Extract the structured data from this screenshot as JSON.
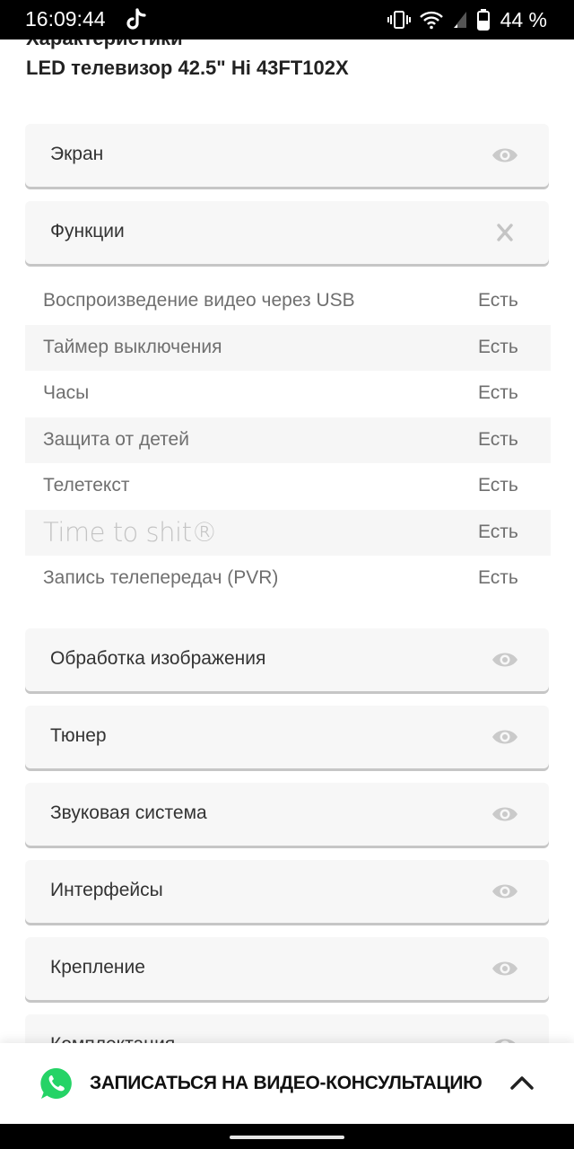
{
  "status_bar": {
    "time": "16:09:44",
    "battery": "44 %"
  },
  "page": {
    "heading": "Характеристики",
    "product": "LED телевизор 42.5\" Hi 43FT102X"
  },
  "sections_top": [
    {
      "label": "Экран",
      "icon": "eye-icon"
    },
    {
      "label": "Функции",
      "icon": "close-icon"
    }
  ],
  "features": [
    {
      "name": "Воспроизведение видео через USB",
      "value": "Есть"
    },
    {
      "name": "Таймер выключения",
      "value": "Есть"
    },
    {
      "name": "Часы",
      "value": "Есть"
    },
    {
      "name": "Защита от детей",
      "value": "Есть"
    },
    {
      "name": "Телетекст",
      "value": "Есть"
    },
    {
      "name": "Time to shit®",
      "value": "Есть"
    },
    {
      "name": "Запись телепередач (PVR)",
      "value": "Есть"
    }
  ],
  "sections_bottom": [
    {
      "label": "Обработка изображения",
      "icon": "eye-icon"
    },
    {
      "label": "Тюнер",
      "icon": "eye-icon"
    },
    {
      "label": "Звуковая система",
      "icon": "eye-icon"
    },
    {
      "label": "Интерфейсы",
      "icon": "eye-icon"
    },
    {
      "label": "Крепление",
      "icon": "eye-icon"
    },
    {
      "label": "Комплектация",
      "icon": "eye-icon"
    }
  ],
  "bottom_bar": {
    "cta": "ЗАПИСАТЬСЯ НА ВИДЕО-КОНСУЛЬТАЦИЮ",
    "icon": "whatsapp-icon",
    "toggle_icon": "chevron-up-icon"
  },
  "colors": {
    "card_bg": "#f7f7f7",
    "row_alt_bg": "#f6f6f6",
    "icon_gray": "#c9c9c9",
    "whatsapp_green": "#25d366"
  }
}
